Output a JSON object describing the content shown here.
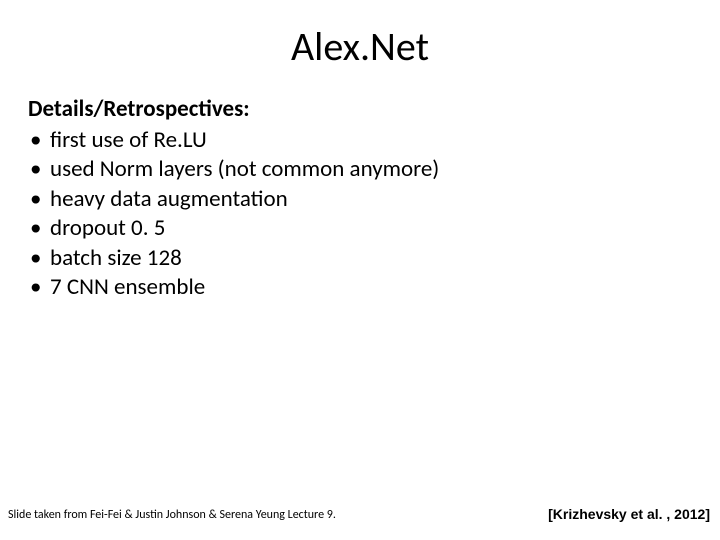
{
  "title": "Alex.Net",
  "subheading": "Details/Retrospectives:",
  "bullets": [
    "first use of Re.LU",
    "used Norm layers (not common anymore)",
    "heavy data augmentation",
    "dropout 0. 5",
    "batch size 128",
    "7 CNN ensemble"
  ],
  "footer_left": "Slide taken from Fei-Fei & Justin Johnson & Serena Yeung  Lecture 9.",
  "footer_right": "[Krizhevsky et al. , 2012]"
}
